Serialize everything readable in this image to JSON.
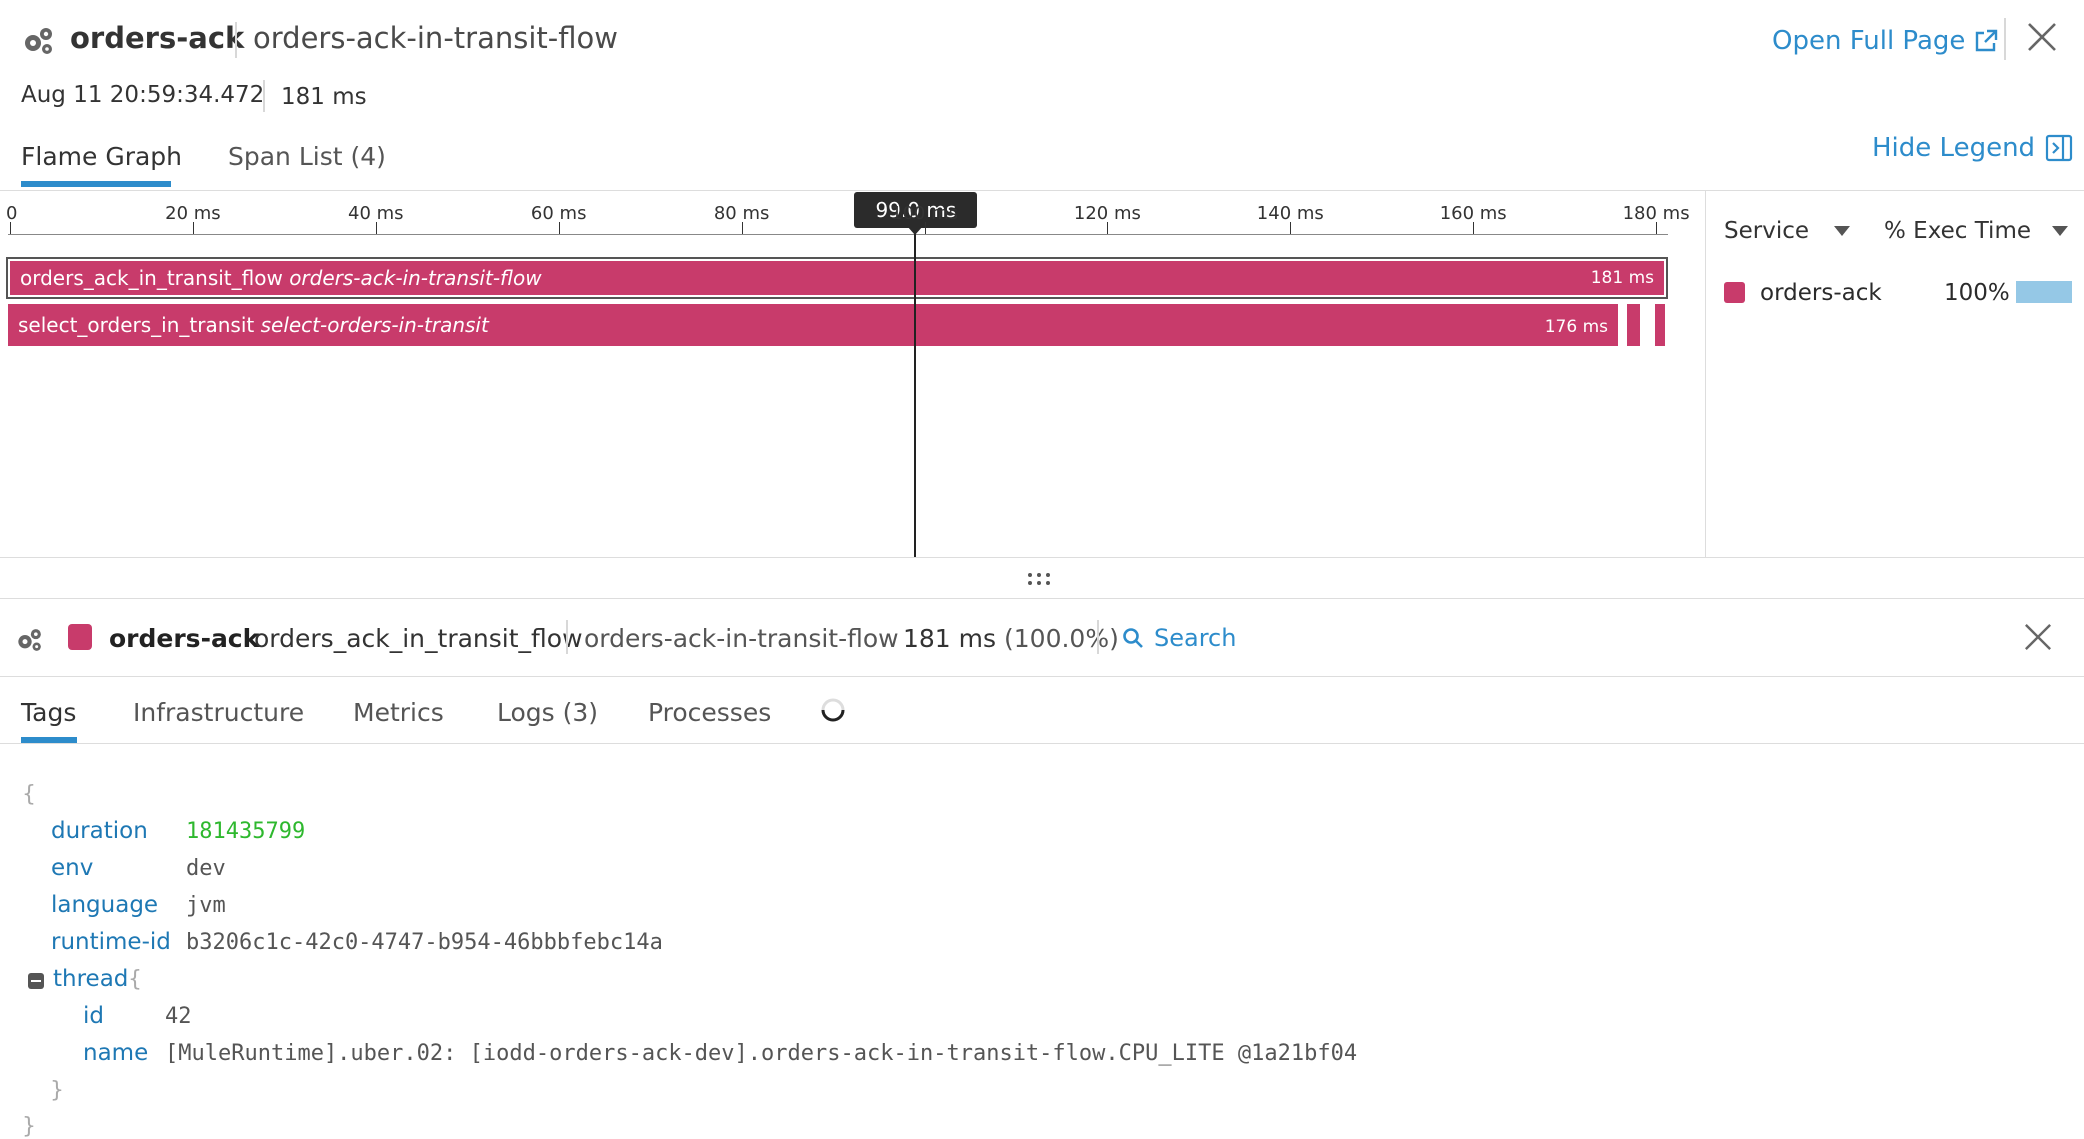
{
  "header": {
    "service": "orders-ack",
    "resource": "orders-ack-in-transit-flow",
    "date": "Aug 11 20:59:34.472",
    "duration": "181 ms",
    "open_full_page": "Open Full Page"
  },
  "tabs": [
    {
      "label": "Flame Graph",
      "active": true
    },
    {
      "label": "Span List (4)",
      "active": false
    }
  ],
  "hide_legend": "Hide Legend",
  "flame": {
    "axis_ticks": [
      "0",
      "20 ms",
      "40 ms",
      "60 ms",
      "80 ms",
      "100 ms",
      "120 ms",
      "140 ms",
      "160 ms",
      "180 ms"
    ],
    "axis_range_ms": [
      0,
      181
    ],
    "cursor_label": "99.0 ms",
    "cursor_ms": 99.0,
    "spans": [
      {
        "name": "orders_ack_in_transit_flow",
        "resource": "orders-ack-in-transit-flow",
        "duration": "181 ms",
        "start_ms": 0,
        "duration_ms": 181
      },
      {
        "name": "select_orders_in_transit",
        "resource": "select-orders-in-transit",
        "duration": "176 ms",
        "start_ms": 0,
        "duration_ms": 176
      }
    ],
    "bar_color": "#c83b6b"
  },
  "legend": {
    "col_service": "Service",
    "col_exec": "% Exec Time",
    "rows": [
      {
        "service": "orders-ack",
        "percent": "100%",
        "color": "#c83b6b",
        "fraction": 1.0
      }
    ]
  },
  "detail": {
    "service": "orders-ack",
    "span_name": "orders_ack_in_transit_flow",
    "resource": "orders-ack-in-transit-flow",
    "duration": "181 ms",
    "duration_pct": "(100.0%)",
    "search": "Search",
    "tabs": [
      {
        "label": "Tags",
        "active": true
      },
      {
        "label": "Infrastructure",
        "active": false
      },
      {
        "label": "Metrics",
        "active": false
      },
      {
        "label": "Logs (3)",
        "active": false
      },
      {
        "label": "Processes",
        "active": false
      }
    ]
  },
  "tags": {
    "open_brace": "{",
    "close_brace": "}",
    "duration": {
      "key": "duration",
      "value": "181435799"
    },
    "env": {
      "key": "env",
      "value": "dev"
    },
    "language": {
      "key": "language",
      "value": "jvm"
    },
    "runtime_id": {
      "key": "runtime-id",
      "value": "b3206c1c-42c0-4747-b954-46bbbfebc14a"
    },
    "thread": {
      "key": "thread",
      "open_brace": "{",
      "close_brace": "}",
      "id": {
        "key": "id",
        "value": "42"
      },
      "name": {
        "key": "name",
        "value": "[MuleRuntime].uber.02: [iodd-orders-ack-dev].orders-ack-in-transit-flow.CPU_LITE @1a21bf04"
      }
    }
  }
}
